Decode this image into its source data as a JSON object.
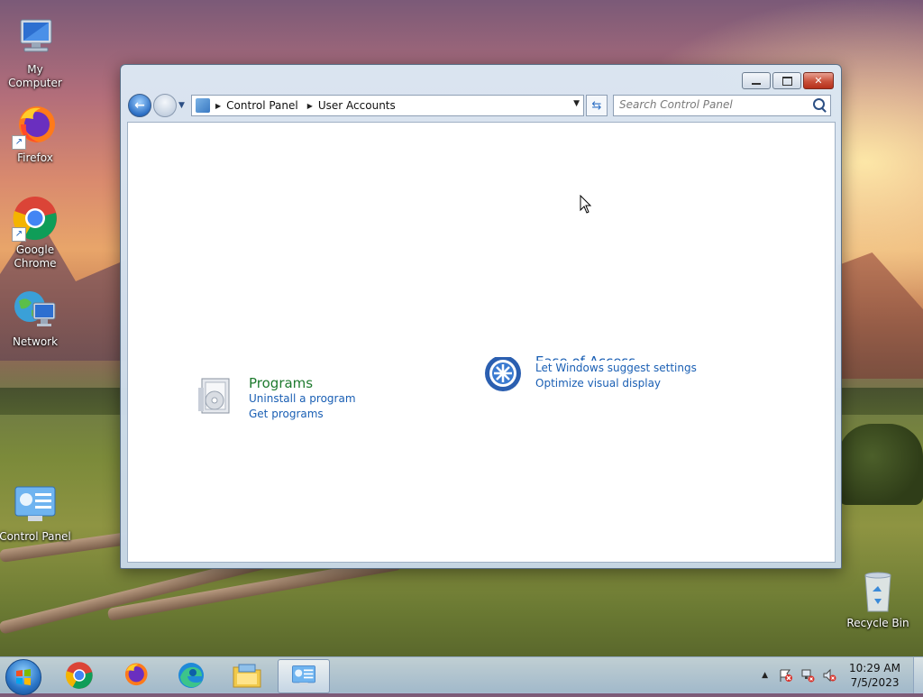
{
  "desktop": {
    "icons": [
      {
        "label": "My Computer"
      },
      {
        "label": "Firefox"
      },
      {
        "label": "Google Chrome"
      },
      {
        "label": "Network"
      },
      {
        "label": "Control Panel"
      },
      {
        "label": "Recycle Bin"
      }
    ]
  },
  "window": {
    "address": {
      "crumbs": [
        "Control Panel",
        "User Accounts"
      ]
    },
    "search": {
      "placeholder": "Search Control Panel"
    },
    "categories": [
      {
        "title": "Programs",
        "links": [
          "Uninstall a program",
          "Get programs"
        ]
      },
      {
        "title": "Ease of Access",
        "links": [
          "Let Windows suggest settings",
          "Optimize visual display"
        ]
      }
    ]
  },
  "taskbar": {
    "apps": [
      "chrome",
      "firefox",
      "edge",
      "file-explorer",
      "control-panel"
    ],
    "clock": {
      "time": "10:29 AM",
      "date": "7/5/2023"
    }
  },
  "colors": {
    "category_title": "#1e7a2e",
    "link": "#1a5fb4",
    "accent": "#2c6fc4"
  }
}
